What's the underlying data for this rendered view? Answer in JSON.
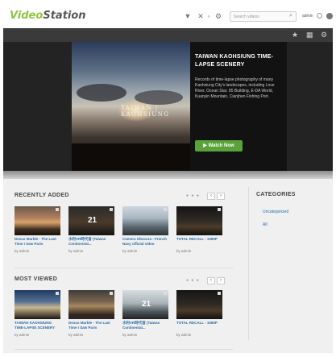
{
  "app": {
    "logo_part1": "Video",
    "logo_part2": "Station"
  },
  "header": {
    "search_placeholder": "Search videos",
    "user": "admin",
    "icons": [
      "filter-icon",
      "tools-icon",
      "settings-icon",
      "search-icon",
      "user-menu-icon",
      "power-icon"
    ]
  },
  "toolbar": {
    "icons": [
      "star-icon",
      "grid-icon",
      "gear-icon"
    ]
  },
  "hero": {
    "overlay_text": "TAIWAN | KAOHSIUNG",
    "title": "TAIWAN KAOHSIUNG TIME-LAPSE SCENERY",
    "description": "Records of time-lapse photography of many Kaohsiung City's landscapes, including Love River, Ocean Star, 85 Building, E-DA World, Kuanyin Mountain, Cianjhen Fishing Port.",
    "watch_label": "Watch Now",
    "play_icon": "play-icon"
  },
  "recently_added": {
    "title": "RECENTLY ADDED",
    "dots": "● ● ●",
    "prev": "‹",
    "next": "›",
    "cards": [
      {
        "title": "Dexus Marble - The Last Time I Saw Paris",
        "by": "by admin",
        "overlay": ""
      },
      {
        "title": "水利VR時代音 (Taiwan Continental...",
        "by": "by admin",
        "overlay": "21"
      },
      {
        "title": "Camera Obscura - French Navy official video",
        "by": "by admin",
        "overlay": ""
      },
      {
        "title": "TOTAL RECALL - 1080P",
        "by": "by admin",
        "overlay": ""
      }
    ]
  },
  "most_viewed": {
    "title": "MOST VIEWED",
    "dots": "● ● ●",
    "prev": "‹",
    "next": "›",
    "cards": [
      {
        "title": "TAIWAN KAOHSIUNG TIME-LAPSE SCENERY",
        "by": "by admin",
        "overlay": ""
      },
      {
        "title": "Dexus Marble - The Last Time I Saw Paris",
        "by": "by admin",
        "overlay": ""
      },
      {
        "title": "水利VR時代音 (Taiwan Continental...",
        "by": "by admin",
        "overlay": "21"
      },
      {
        "title": "TOTAL RECALL - 1080P",
        "by": "by admin",
        "overlay": ""
      }
    ]
  },
  "categories": {
    "title": "CATEGORIES",
    "items": [
      "Uncategorized",
      "All"
    ]
  }
}
